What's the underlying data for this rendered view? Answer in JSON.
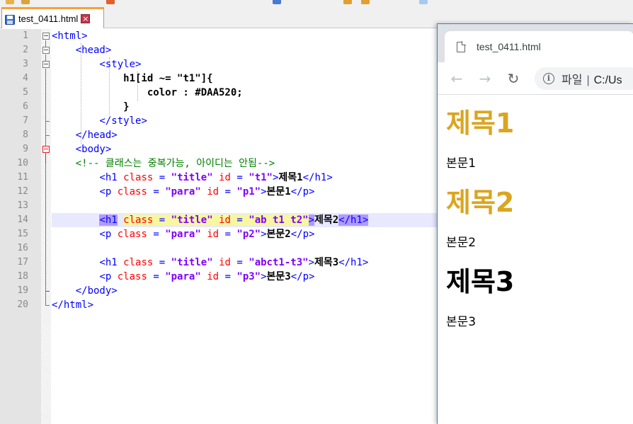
{
  "editor": {
    "tab_label": "test_0411.html",
    "close_glyph": "×",
    "line_numbers": [
      "1",
      "2",
      "3",
      "4",
      "5",
      "6",
      "7",
      "8",
      "9",
      "10",
      "11",
      "12",
      "13",
      "14",
      "15",
      "16",
      "17",
      "18",
      "19",
      "20"
    ],
    "lines": {
      "l1": {
        "open": "<html>"
      },
      "l2": {
        "open": "<head>"
      },
      "l3": {
        "open": "<style>"
      },
      "l4": {
        "text": "h1[id ~= \"t1\"]{"
      },
      "l5": {
        "text": "color : #DAA520;"
      },
      "l6": {
        "text": "}"
      },
      "l7": {
        "close": "</style>"
      },
      "l8": {
        "close": "</head>"
      },
      "l9": {
        "open": "<body>"
      },
      "l10": {
        "comment": "<!-- 클래스는 중복가능, 아이디는 안됨-->"
      },
      "l11": {
        "tag": "<h1",
        "class_attr": "class",
        "eq": "=",
        "class_val": "\"title\"",
        "id_attr": "id",
        "id_val": "\"t1\"",
        "gt": ">",
        "content": "제목1",
        "end": "</h1>"
      },
      "l12": {
        "tag": "<p",
        "class_attr": "class",
        "eq": "=",
        "class_val": "\"para\"",
        "id_attr": "id",
        "id_val": "\"p1\"",
        "gt": ">",
        "content": "본문1",
        "end": "</p>"
      },
      "l14": {
        "tag": "<h1",
        "class_attr": "class",
        "eq": "=",
        "class_val": "\"title\"",
        "id_attr": "id",
        "id_val": "\"ab t1 t2\"",
        "gt": ">",
        "content": "제목2",
        "end": "</h1>"
      },
      "l15": {
        "tag": "<p",
        "class_attr": "class",
        "eq": "=",
        "class_val": "\"para\"",
        "id_attr": "id",
        "id_val": "\"p2\"",
        "gt": ">",
        "content": "본문2",
        "end": "</p>"
      },
      "l17": {
        "tag": "<h1",
        "class_attr": "class",
        "eq": "=",
        "class_val": "\"title\"",
        "id_attr": "id",
        "id_val": "\"abct1-t3\"",
        "gt": ">",
        "content": "제목3",
        "end": "</h1>"
      },
      "l18": {
        "tag": "<p",
        "class_attr": "class",
        "eq": "=",
        "class_val": "\"para\"",
        "id_attr": "id",
        "id_val": "\"p3\"",
        "gt": ">",
        "content": "본문3",
        "end": "</p>"
      },
      "l19": {
        "close": "</body>"
      },
      "l20": {
        "close": "</html>"
      }
    },
    "colors": {
      "tag": "#0000ff",
      "attr": "#ff0000",
      "value": "#8000ff",
      "comment": "#008000",
      "tab_accent": "#f7a13b"
    }
  },
  "browser": {
    "tab_title": "test_0411.html",
    "back_icon": "←",
    "forward_icon": "→",
    "reload_icon": "↻",
    "info_icon": "i",
    "address_prefix": "파일",
    "address_sep": "|",
    "address_url": "C:/Us",
    "content": {
      "h1_1": "제목1",
      "p_1": "본문1",
      "h1_2": "제목2",
      "p_2": "본문2",
      "h1_3": "제목3",
      "p_3": "본문3"
    },
    "colors": {
      "highlight_heading": "#DAA520",
      "plain_heading": "#000000"
    }
  }
}
